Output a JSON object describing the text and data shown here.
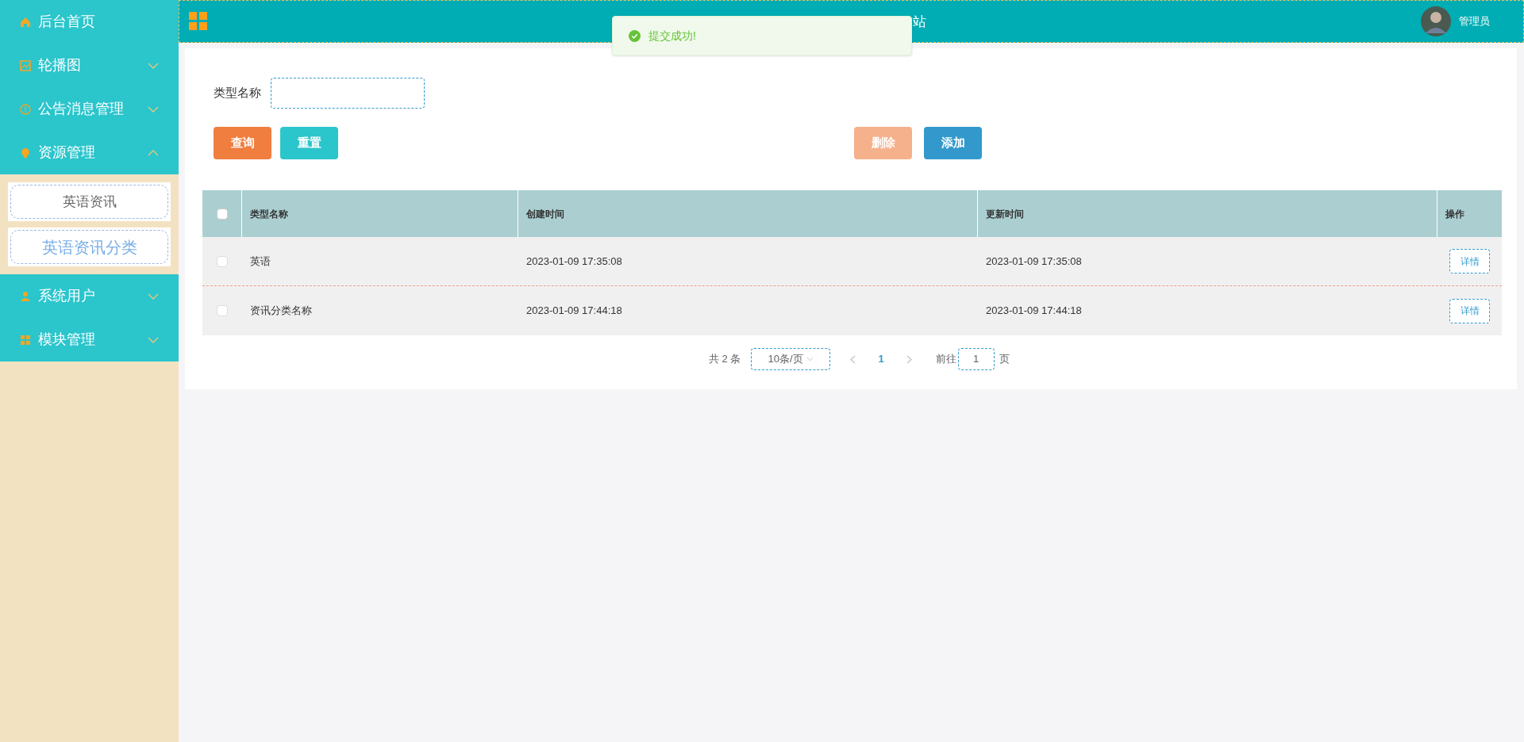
{
  "sidebar": {
    "items": [
      {
        "label": "后台首页"
      },
      {
        "label": "轮播图",
        "expanded": false
      },
      {
        "label": "公告消息管理",
        "expanded": false
      },
      {
        "label": "资源管理",
        "expanded": true,
        "children": [
          {
            "label": "英语资讯",
            "selected": false
          },
          {
            "label": "英语资讯分类",
            "selected": true
          }
        ]
      },
      {
        "label": "系统用户",
        "expanded": false
      },
      {
        "label": "模块管理",
        "expanded": false
      }
    ]
  },
  "header": {
    "title": "站",
    "user": "管理员"
  },
  "toast": {
    "message": "提交成功!"
  },
  "search": {
    "label": "类型名称"
  },
  "buttons": [
    {
      "label": "查询",
      "kind": "query"
    },
    {
      "label": "重置",
      "kind": "reset"
    },
    {
      "label": "删除",
      "kind": "delete",
      "disabled": true
    },
    {
      "label": "添加",
      "kind": "add",
      "disabled": false
    }
  ],
  "table": {
    "columns": [
      "类型名称",
      "创建时间",
      "更新时间",
      "操作"
    ],
    "all_checked": false,
    "rows": [
      {
        "checked": false,
        "cells": [
          "英语",
          "2023-01-09 17:35:08",
          "2023-01-09 17:35:08"
        ],
        "action": "详情"
      },
      {
        "checked": false,
        "cells": [
          "资讯分类名称",
          "2023-01-09 17:44:18",
          "2023-01-09 17:44:18"
        ],
        "action": "详情"
      }
    ]
  },
  "pagination": {
    "total": "共 2 条",
    "page_size": "10条/页",
    "pages": [
      {
        "label": "1",
        "selected": true
      }
    ],
    "goto_label": "前往",
    "goto_value": "1",
    "goto_suffix": "页"
  }
}
